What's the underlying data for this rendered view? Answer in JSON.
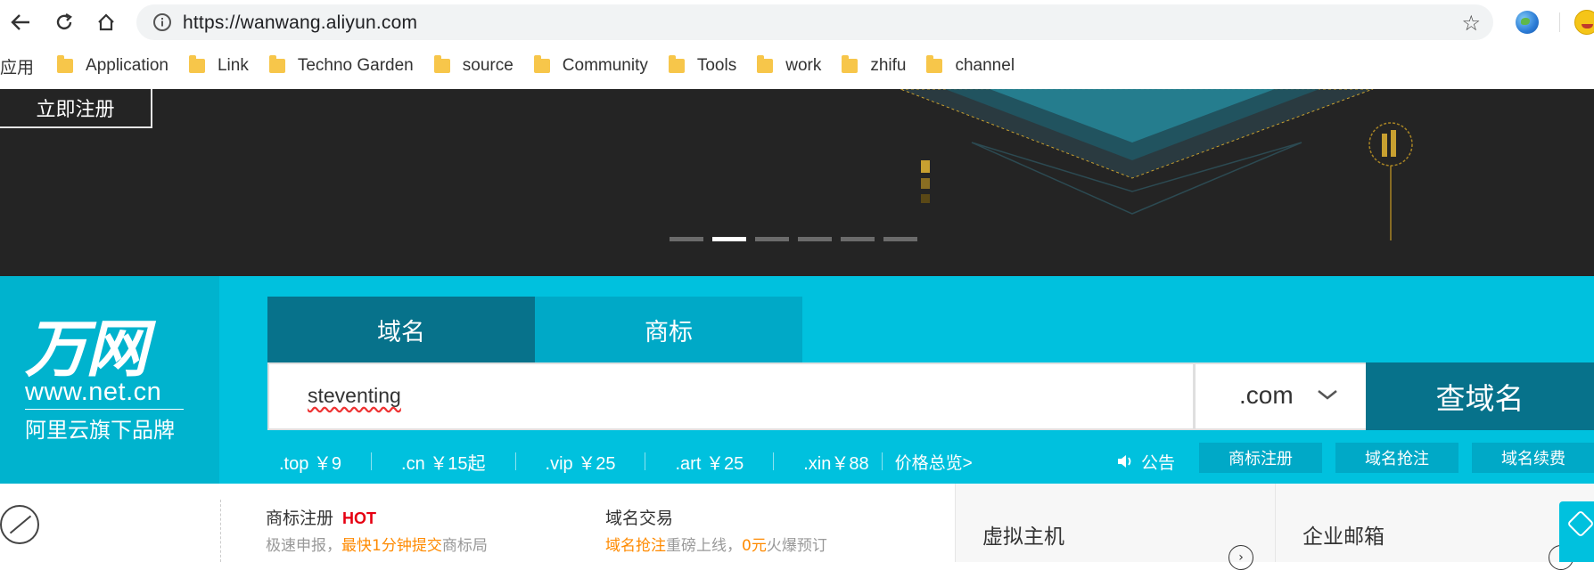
{
  "browser": {
    "url": "https://wanwang.aliyun.com",
    "bookmarks_apps": "应用",
    "bookmarks": [
      "Application",
      "Link",
      "Techno Garden",
      "source",
      "Community",
      "Tools",
      "work",
      "zhifu",
      "channel"
    ]
  },
  "hero": {
    "register_button": "立即注册",
    "carousel_active_index": 1,
    "carousel_count": 6
  },
  "logo": {
    "title": "万网",
    "url": "www.net.cn",
    "subtitle": "阿里云旗下品牌"
  },
  "search": {
    "tabs": [
      "域名",
      "商标"
    ],
    "active_tab": "域名",
    "query": "steventing",
    "suffix": ".com",
    "button": "查域名",
    "prices": [
      {
        "tld": ".top",
        "price": "￥9"
      },
      {
        "tld": ".cn",
        "price": "￥15起"
      },
      {
        "tld": ".vip",
        "price": "￥25"
      },
      {
        "tld": ".art",
        "price": "￥25"
      },
      {
        "tld": ".xin",
        "price": "￥88"
      }
    ],
    "price_overview": "价格总览>",
    "notice": "公告",
    "quick_buttons": [
      "商标注册",
      "域名抢注",
      "域名续费"
    ]
  },
  "features": {
    "trademark": {
      "title": "商标注册",
      "badge": "HOT",
      "desc_prefix": "极速申报，",
      "desc_highlight": "最快1分钟提交",
      "desc_suffix": "商标局"
    },
    "domain_trade": {
      "title": "域名交易",
      "desc_highlight1": "域名抢注",
      "desc_middle": "重磅上线，",
      "desc_highlight2": "0元",
      "desc_suffix": "火爆预订"
    }
  },
  "cards": [
    {
      "title": "虚拟主机"
    },
    {
      "title": "企业邮箱"
    }
  ],
  "colors": {
    "band": "#00c1de",
    "dark_teal": "#07728b",
    "tab_inactive": "#00a9c7",
    "hero_bg": "#242424",
    "hot": "#e60012",
    "highlight": "#ff8a00"
  }
}
